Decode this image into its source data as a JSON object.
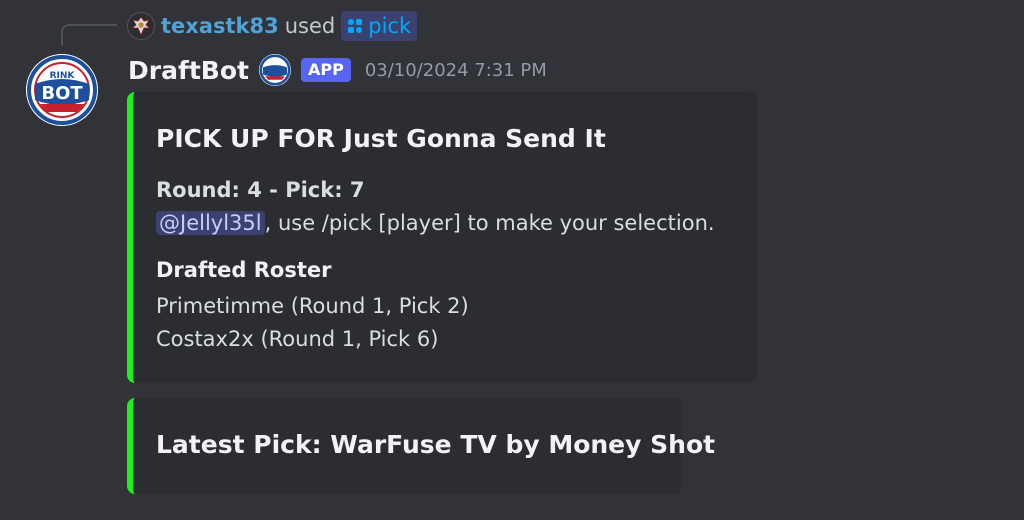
{
  "reply": {
    "user": "texastk83",
    "verb": "used",
    "command": "pick",
    "command_icon": "app-command-icon"
  },
  "message": {
    "author": "DraftBot",
    "author_tag": "APP",
    "timestamp": "03/10/2024 7:31 PM",
    "avatar_icon": "rink-bot-logo",
    "avatar_logo_text": [
      "RINK",
      "BOT"
    ]
  },
  "embeds": [
    {
      "accent": "#1df01d",
      "title": "PICK UP FOR Just Gonna Send It",
      "round_line": "Round: 4 - Pick: 7",
      "mention": "@Jellyl35l",
      "instruction": ", use /pick [player] to make your selection.",
      "roster_heading": "Drafted Roster",
      "roster": [
        "Primetimme (Round 1, Pick 2)",
        "Costax2x (Round 1, Pick 6)"
      ]
    },
    {
      "accent": "#1df01d",
      "title": "Latest Pick: WarFuse TV by Money Shot"
    }
  ],
  "colors": {
    "background": "#313338",
    "embed_bg": "#2b2d31",
    "link_blue": "#00a8fc",
    "app_tag": "#5865f2"
  }
}
